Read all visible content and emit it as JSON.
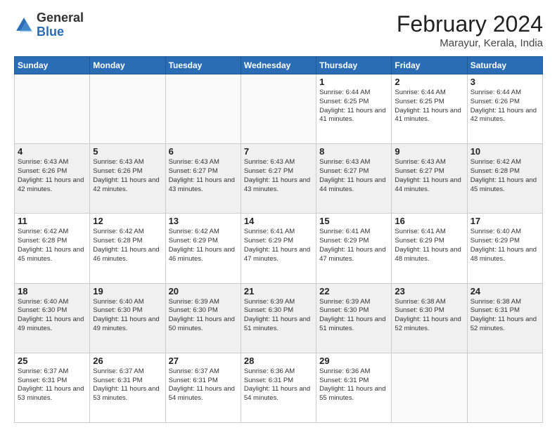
{
  "header": {
    "logo_general": "General",
    "logo_blue": "Blue",
    "title": "February 2024",
    "location": "Marayur, Kerala, India"
  },
  "weekdays": [
    "Sunday",
    "Monday",
    "Tuesday",
    "Wednesday",
    "Thursday",
    "Friday",
    "Saturday"
  ],
  "weeks": [
    [
      {
        "day": "",
        "info": ""
      },
      {
        "day": "",
        "info": ""
      },
      {
        "day": "",
        "info": ""
      },
      {
        "day": "",
        "info": ""
      },
      {
        "day": "1",
        "info": "Sunrise: 6:44 AM\nSunset: 6:25 PM\nDaylight: 11 hours and 41 minutes."
      },
      {
        "day": "2",
        "info": "Sunrise: 6:44 AM\nSunset: 6:25 PM\nDaylight: 11 hours and 41 minutes."
      },
      {
        "day": "3",
        "info": "Sunrise: 6:44 AM\nSunset: 6:26 PM\nDaylight: 11 hours and 42 minutes."
      }
    ],
    [
      {
        "day": "4",
        "info": "Sunrise: 6:43 AM\nSunset: 6:26 PM\nDaylight: 11 hours and 42 minutes."
      },
      {
        "day": "5",
        "info": "Sunrise: 6:43 AM\nSunset: 6:26 PM\nDaylight: 11 hours and 42 minutes."
      },
      {
        "day": "6",
        "info": "Sunrise: 6:43 AM\nSunset: 6:27 PM\nDaylight: 11 hours and 43 minutes."
      },
      {
        "day": "7",
        "info": "Sunrise: 6:43 AM\nSunset: 6:27 PM\nDaylight: 11 hours and 43 minutes."
      },
      {
        "day": "8",
        "info": "Sunrise: 6:43 AM\nSunset: 6:27 PM\nDaylight: 11 hours and 44 minutes."
      },
      {
        "day": "9",
        "info": "Sunrise: 6:43 AM\nSunset: 6:27 PM\nDaylight: 11 hours and 44 minutes."
      },
      {
        "day": "10",
        "info": "Sunrise: 6:42 AM\nSunset: 6:28 PM\nDaylight: 11 hours and 45 minutes."
      }
    ],
    [
      {
        "day": "11",
        "info": "Sunrise: 6:42 AM\nSunset: 6:28 PM\nDaylight: 11 hours and 45 minutes."
      },
      {
        "day": "12",
        "info": "Sunrise: 6:42 AM\nSunset: 6:28 PM\nDaylight: 11 hours and 46 minutes."
      },
      {
        "day": "13",
        "info": "Sunrise: 6:42 AM\nSunset: 6:29 PM\nDaylight: 11 hours and 46 minutes."
      },
      {
        "day": "14",
        "info": "Sunrise: 6:41 AM\nSunset: 6:29 PM\nDaylight: 11 hours and 47 minutes."
      },
      {
        "day": "15",
        "info": "Sunrise: 6:41 AM\nSunset: 6:29 PM\nDaylight: 11 hours and 47 minutes."
      },
      {
        "day": "16",
        "info": "Sunrise: 6:41 AM\nSunset: 6:29 PM\nDaylight: 11 hours and 48 minutes."
      },
      {
        "day": "17",
        "info": "Sunrise: 6:40 AM\nSunset: 6:29 PM\nDaylight: 11 hours and 48 minutes."
      }
    ],
    [
      {
        "day": "18",
        "info": "Sunrise: 6:40 AM\nSunset: 6:30 PM\nDaylight: 11 hours and 49 minutes."
      },
      {
        "day": "19",
        "info": "Sunrise: 6:40 AM\nSunset: 6:30 PM\nDaylight: 11 hours and 49 minutes."
      },
      {
        "day": "20",
        "info": "Sunrise: 6:39 AM\nSunset: 6:30 PM\nDaylight: 11 hours and 50 minutes."
      },
      {
        "day": "21",
        "info": "Sunrise: 6:39 AM\nSunset: 6:30 PM\nDaylight: 11 hours and 51 minutes."
      },
      {
        "day": "22",
        "info": "Sunrise: 6:39 AM\nSunset: 6:30 PM\nDaylight: 11 hours and 51 minutes."
      },
      {
        "day": "23",
        "info": "Sunrise: 6:38 AM\nSunset: 6:30 PM\nDaylight: 11 hours and 52 minutes."
      },
      {
        "day": "24",
        "info": "Sunrise: 6:38 AM\nSunset: 6:31 PM\nDaylight: 11 hours and 52 minutes."
      }
    ],
    [
      {
        "day": "25",
        "info": "Sunrise: 6:37 AM\nSunset: 6:31 PM\nDaylight: 11 hours and 53 minutes."
      },
      {
        "day": "26",
        "info": "Sunrise: 6:37 AM\nSunset: 6:31 PM\nDaylight: 11 hours and 53 minutes."
      },
      {
        "day": "27",
        "info": "Sunrise: 6:37 AM\nSunset: 6:31 PM\nDaylight: 11 hours and 54 minutes."
      },
      {
        "day": "28",
        "info": "Sunrise: 6:36 AM\nSunset: 6:31 PM\nDaylight: 11 hours and 54 minutes."
      },
      {
        "day": "29",
        "info": "Sunrise: 6:36 AM\nSunset: 6:31 PM\nDaylight: 11 hours and 55 minutes."
      },
      {
        "day": "",
        "info": ""
      },
      {
        "day": "",
        "info": ""
      }
    ]
  ]
}
